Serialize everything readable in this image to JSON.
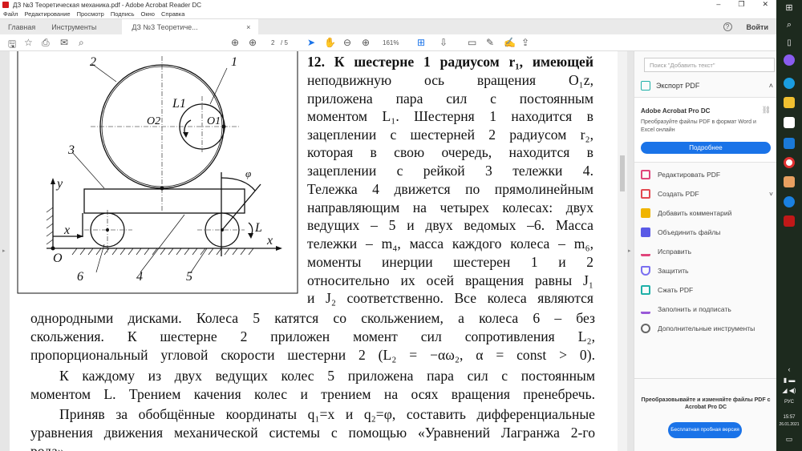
{
  "window": {
    "title": "ДЗ №3 Теоретическая механика.pdf - Adobe Acrobat Reader DC",
    "minimize": "–",
    "restore": "❐",
    "close": "✕"
  },
  "menu": [
    "Файл",
    "Редактирование",
    "Просмотр",
    "Подпись",
    "Окно",
    "Справка"
  ],
  "tabs": {
    "home": "Главная",
    "tools": "Инструменты",
    "doc": "ДЗ №3 Теоретиче...",
    "doc_close": "×",
    "help": "?",
    "login": "Войти"
  },
  "toolbar": {
    "page_current": "2",
    "page_total": "/ 5",
    "zoom": "161%"
  },
  "figure": {
    "labels": [
      "2",
      "1",
      "L1",
      "O2",
      "O1",
      "3",
      "y",
      "φ",
      "x",
      "L",
      "x",
      "O",
      "6",
      "4",
      "5"
    ]
  },
  "page_text": {
    "right_lines": [
      "12. К шестерне 1 радиусом r₁, имеющей",
      "неподвижную ось вращения O₁z,",
      "приложена пара сил с постоянным",
      "моментом L₁. Шестерня 1 находится в",
      "зацеплении с шестерней 2 радиусом r₂,",
      "которая в свою очередь, находится в",
      "зацеплении с рейкой 3 тележки 4.",
      "Тележка 4 движется по прямолинейным",
      "направляющим на четырех колесах: двух",
      "ведущих – 5 и двух ведомых –6. Масса",
      "тележки – m₄, масса каждого колеса – m₆,",
      "моменты инерции шестерен 1 и 2",
      "относительно их осей вращения равны J₁",
      "и J₂ соответственно. Все колеса являются"
    ],
    "full_lines": [
      "однородными дисками. Колеса 5 катятся со скольжением, а колеса 6 – без",
      "скольжения. К шестерне 2 приложен момент сил сопротивления L₂,",
      "пропорциональный угловой скорости шестерни 2 (L₂ = −αω₂, α = const > 0).",
      "К каждому из двух ведущих колес 5 приложена пара сил с постоянным",
      "моментом L. Трением качения колес и трением на осях вращения пренебречь.",
      "Приняв за обобщённые координаты q₁=x и q₂=φ, составить дифференциальные",
      "уравнения движения механической системы с помощью «Уравнений Лагранжа 2-го",
      "рода»."
    ]
  },
  "sidebar": {
    "search_placeholder": "Поиск \"Добавить текст\"",
    "export": "Экспорт PDF",
    "promo_title": "Adobe Acrobat Pro DC",
    "promo_text": "Преобразуйте файлы PDF в формат Word и Excel онлайн",
    "promo_button": "Подробнее",
    "items": [
      {
        "label": "Редактировать PDF",
        "color": "#e0457b"
      },
      {
        "label": "Создать PDF",
        "color": "#e34850"
      },
      {
        "label": "Добавить комментарий",
        "color": "#f0b400"
      },
      {
        "label": "Объединить файлы",
        "color": "#5a5ae6"
      },
      {
        "label": "Исправить",
        "color": "#e0457b"
      },
      {
        "label": "Защитить",
        "color": "#7a6ff0"
      },
      {
        "label": "Сжать PDF",
        "color": "#1fb0a8"
      },
      {
        "label": "Заполнить и подписать",
        "color": "#9a5ad8"
      },
      {
        "label": "Дополнительные инструменты",
        "color": "#666666"
      }
    ],
    "bottom_text": "Преобразовывайте и изменяйте файлы PDF с Acrobat Pro DC",
    "trial_button": "Бесплатная пробная версия"
  },
  "taskbar": {
    "lang": "РУС",
    "time": "15:57",
    "date": "26.01.2021"
  }
}
